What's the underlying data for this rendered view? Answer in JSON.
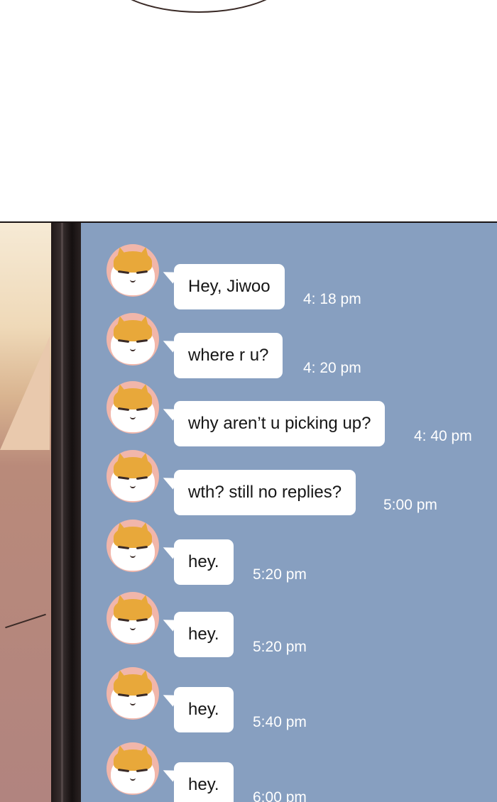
{
  "chat": {
    "messages": [
      {
        "text": "Hey, Jiwoo",
        "time": "4: 18 pm"
      },
      {
        "text": "where r u?",
        "time": "4: 20 pm"
      },
      {
        "text": "why aren’t u picking up?",
        "time": "4: 40 pm"
      },
      {
        "text": "wth? still no replies?",
        "time": "5:00 pm"
      },
      {
        "text": "hey.",
        "time": "5:20 pm"
      },
      {
        "text": "hey.",
        "time": "5:20 pm"
      },
      {
        "text": "hey.",
        "time": "5:40 pm"
      },
      {
        "text": "hey.",
        "time": "6:00 pm"
      }
    ]
  },
  "colors": {
    "chat_background": "#879fc0",
    "bubble": "#ffffff",
    "avatar_background": "#f1b6aa",
    "cat_fur": "#e8a83a"
  },
  "icons": {
    "avatar": "cat-face-icon"
  }
}
